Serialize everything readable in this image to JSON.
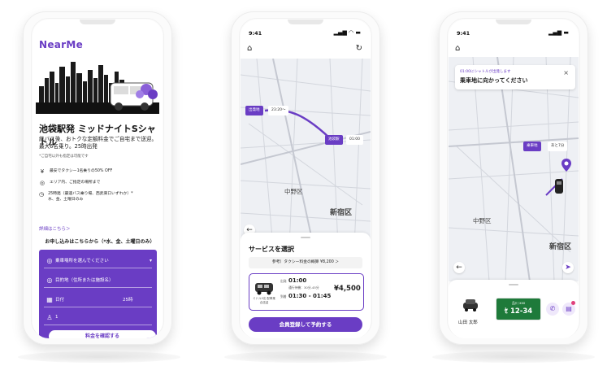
{
  "phone1": {
    "logo": "NearMe",
    "title": "池袋駅発 ミッドナイトSシャトル",
    "desc": "終バス後、おトクな定額料金でご自宅まで送迎。最大6名乗り。25時出発",
    "small_note": "*ご自宅以外も指定は可能です",
    "features": [
      {
        "icon": "yen-icon",
        "glyph": "¥",
        "text": "最安でタクシー1名乗りの50% OFF"
      },
      {
        "icon": "pin-icon",
        "glyph": "◎",
        "text": "エリア内、ご指定の場所まで"
      },
      {
        "icon": "clock-icon",
        "glyph": "◷",
        "text": "25時発（最速バス乗り場、西武東口いずれか）*水、金、土曜日のみ"
      }
    ],
    "details_link": "詳細はこちら＞",
    "apply_heading": "お申し込みはこちらから（*水、金、土曜日のみ）",
    "form": {
      "pickup_placeholder": "乗車場所を選んでください",
      "destination_placeholder": "目的地（住所または施設名）",
      "date_label": "日付",
      "time_value": "25時",
      "passengers_value": "1",
      "submit_label": "料金を確認する"
    }
  },
  "phone2": {
    "time": "9:41",
    "tag_depart": "出発地",
    "tag_time": "23:20〜",
    "tag_arrive": "池袋駅",
    "tag_time2": "01:00",
    "map_label1": "中野区",
    "map_label2": "新宿区",
    "sheet_title": "サービスを選択",
    "reference": "参考）タクシー料金の概算 ¥8,200 ＞",
    "option": {
      "pickup_tag": "出発",
      "pickup_time": "01:00",
      "wait_note": "通行待機：30分-45分",
      "arrive_tag": "到着",
      "arrive_time": "01:30 - 01:45",
      "price": "¥4,500",
      "vehicle_note": "ミドル5名 配車乗合送迎"
    },
    "cta": "会員登録して予約する"
  },
  "phone3": {
    "time": "9:41",
    "bubble_small": "01:00にシャトルが出発します",
    "bubble_main": "乗車地に向かってください",
    "tag_pickup": "乗車地",
    "tag_mins": "あと7分",
    "map_label1": "中野区",
    "map_label2": "新宿区",
    "driver_name": "山田 太郎",
    "plate_top": "品川 xxx",
    "plate_main": "ｾ 12-34"
  },
  "colors": {
    "accent": "#6a3dc4",
    "plate": "#1e7a3a"
  }
}
